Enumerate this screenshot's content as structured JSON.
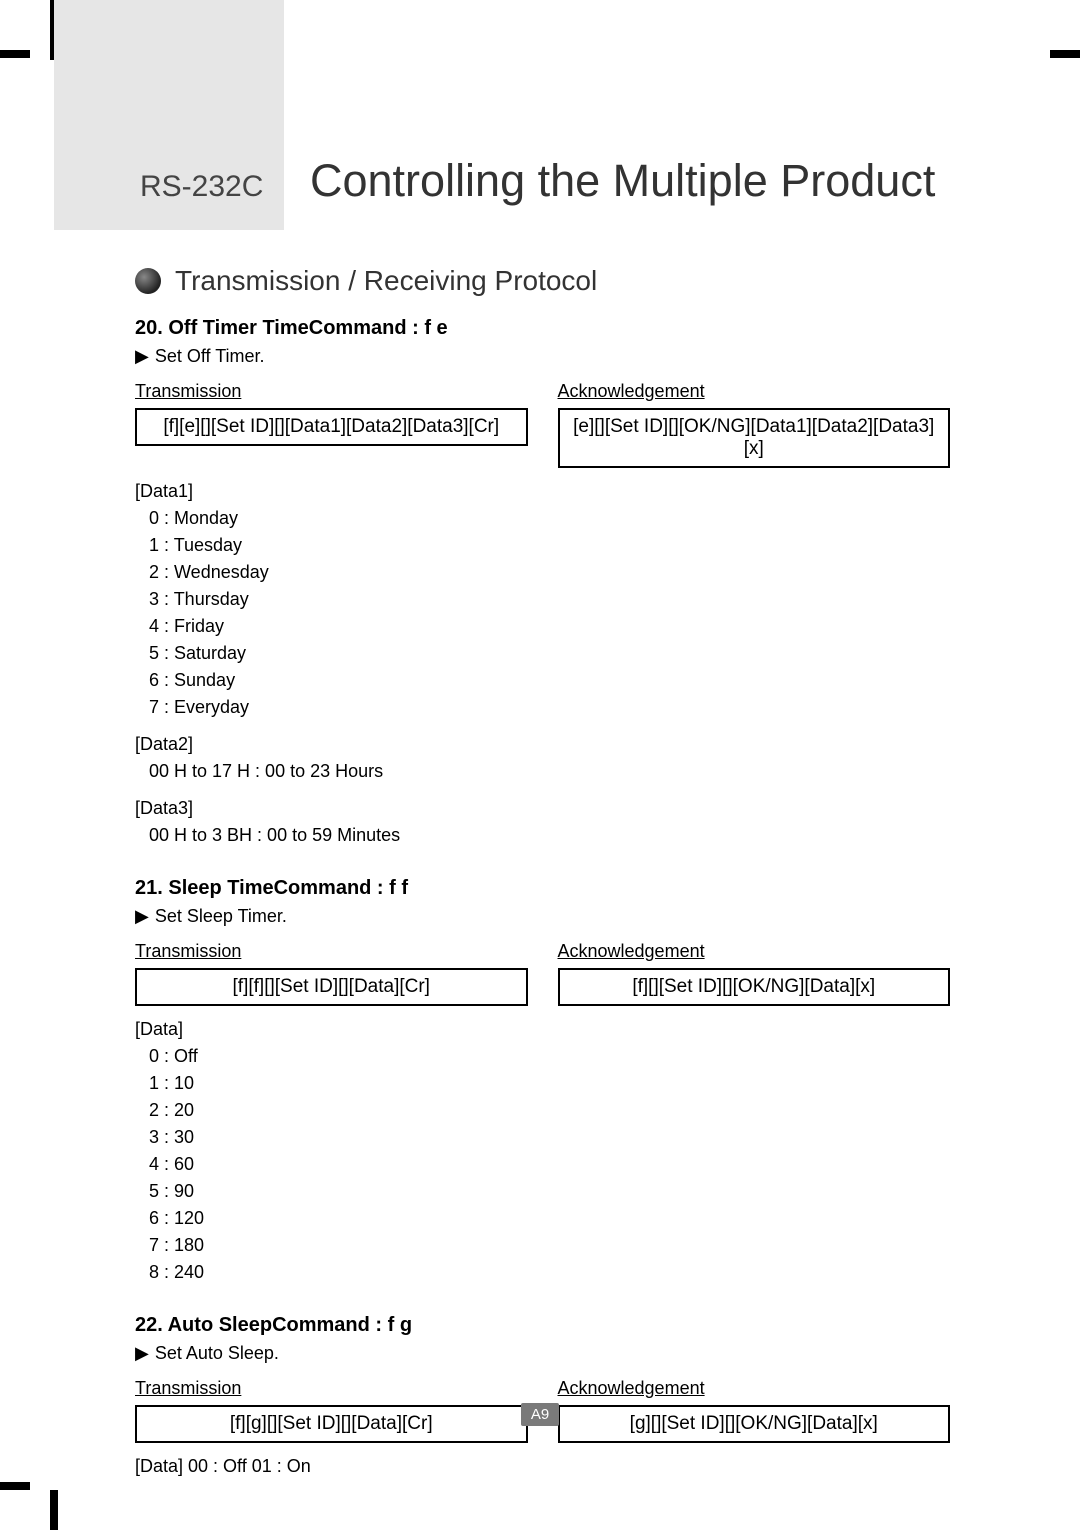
{
  "header": {
    "left": "RS-232C",
    "right": "Controlling the Multiple Product"
  },
  "section_title": "Transmission / Receiving Protocol",
  "labels": {
    "transmission": "Transmission",
    "acknowledgement": "Acknowledgement",
    "arrow": "▶"
  },
  "cmd20": {
    "title": "20. Off Timer TimeCommand : f e",
    "sub": "Set Off Timer.",
    "tx": "[f][e][][Set ID][][Data1][Data2][Data3][Cr]",
    "ack": "[e][][Set ID][][OK/NG][Data1][Data2][Data3][x]",
    "data1_label": "[Data1]",
    "data1_items": [
      "0 : Monday",
      "1 : Tuesday",
      "2 : Wednesday",
      "3 : Thursday",
      "4 : Friday",
      "5 : Saturday",
      "6 : Sunday",
      "7 : Everyday"
    ],
    "data2_label": "[Data2]",
    "data2_text": "00 H to 17 H : 00 to 23 Hours",
    "data3_label": "[Data3]",
    "data3_text": "00 H to 3 BH : 00 to 59 Minutes"
  },
  "cmd21": {
    "title": "21. Sleep TimeCommand : f f",
    "sub": "Set Sleep Timer.",
    "tx": "[f][f][][Set ID][][Data][Cr]",
    "ack": "[f][][Set ID][][OK/NG][Data][x]",
    "data_label": "[Data]",
    "data_items": [
      "0 : Off",
      "1 : 10",
      "2 : 20",
      "3 : 30",
      "4 : 60",
      "5 : 90",
      "6 : 120",
      "7 : 180",
      "8 : 240"
    ]
  },
  "cmd22": {
    "title": "22. Auto SleepCommand : f g",
    "sub": "Set Auto Sleep.",
    "tx": "[f][g][][Set ID][][Data][Cr]",
    "ack": "[g][][Set ID][][OK/NG][Data][x]",
    "data_line": "[Data] 00 : Off    01 : On"
  },
  "page_number": "A9"
}
